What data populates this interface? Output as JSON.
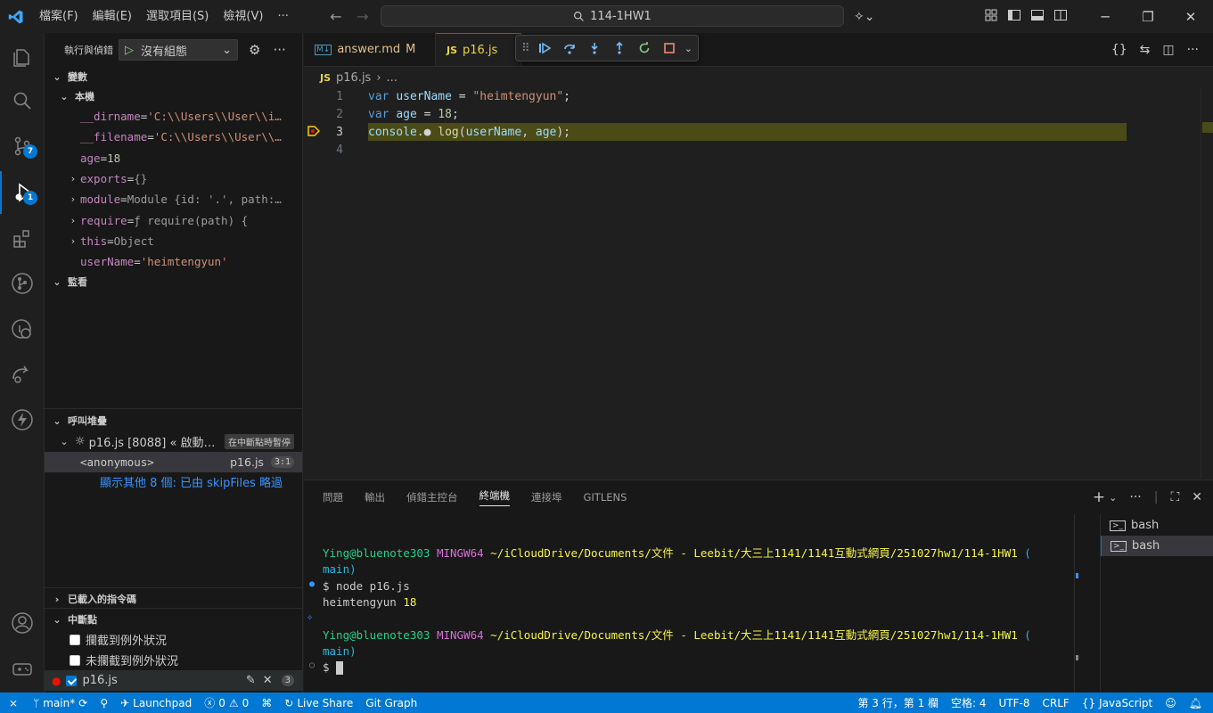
{
  "titlebar": {
    "menus": [
      "檔案(F)",
      "編輯(E)",
      "選取項目(S)",
      "檢視(V)",
      "···"
    ],
    "search": "114-1HW1"
  },
  "activity": {
    "scm_badge": "7",
    "debug_badge": "1"
  },
  "sidebar": {
    "header_title": "執行與偵錯",
    "config_label": "沒有組態",
    "variables_title": "變數",
    "local_title": "本機",
    "variables": [
      {
        "name": "__dirname",
        "sep": " = ",
        "value": "'C:\\\\Users\\\\User\\\\i…",
        "kind": "str",
        "expandable": false
      },
      {
        "name": "__filename",
        "sep": " = ",
        "value": "'C:\\\\Users\\\\User\\\\…",
        "kind": "str",
        "expandable": false
      },
      {
        "name": "age",
        "sep": " = ",
        "value": "18",
        "kind": "num",
        "expandable": false
      },
      {
        "name": "exports",
        "sep": " = ",
        "value": "{}",
        "kind": "obj",
        "expandable": true
      },
      {
        "name": "module",
        "sep": " = ",
        "value": "Module {id: '.', path:…",
        "kind": "obj",
        "expandable": true
      },
      {
        "name": "require",
        "sep": " = ",
        "value": "ƒ require(path) {",
        "kind": "obj",
        "expandable": true
      },
      {
        "name": "this",
        "sep": " = ",
        "value": "Object",
        "kind": "obj",
        "expandable": true
      },
      {
        "name": "userName",
        "sep": " = ",
        "value": "'heimtengyun'",
        "kind": "str",
        "expandable": false
      }
    ],
    "watch_title": "監看",
    "callstack_title": "呼叫堆疊",
    "callstack_thread": "p16.js [8088] « 啟動…",
    "callstack_status": "在中斷點時暫停",
    "frame_name": "<anonymous>",
    "frame_file": "p16.js",
    "frame_pos": "3:1",
    "more_frames": "顯示其他 8 個: 已由 skipFiles 略過",
    "loaded_scripts_title": "已載入的指令碼",
    "breakpoints_title": "中斷點",
    "bp_caught": "攔截到例外狀況",
    "bp_uncaught": "未攔截到例外狀況",
    "bp_file": "p16.js",
    "bp_count": "3"
  },
  "editor": {
    "tabs": [
      {
        "label": "answer.md",
        "status": "M",
        "icon": "M↓"
      },
      {
        "label": "p16.js",
        "icon": "JS"
      }
    ],
    "breadcrumb_file": "p16.js",
    "breadcrumb_more": "...",
    "lines": [
      {
        "n": "1",
        "tokens": [
          [
            "kw",
            "var "
          ],
          [
            "id",
            "userName"
          ],
          [
            "pl",
            " = "
          ],
          [
            "str",
            "\"heimtengyun\""
          ],
          [
            "pl",
            ";"
          ]
        ]
      },
      {
        "n": "2",
        "tokens": [
          [
            "kw",
            "var "
          ],
          [
            "id",
            "age"
          ],
          [
            "pl",
            " = "
          ],
          [
            "num",
            "18"
          ],
          [
            "pl",
            ";"
          ]
        ]
      },
      {
        "n": "3",
        "tokens": [
          [
            "id",
            "console"
          ],
          [
            "pl",
            ".● "
          ],
          [
            "fn",
            "log"
          ],
          [
            "pl",
            "("
          ],
          [
            "id",
            "userName"
          ],
          [
            "pl",
            ", "
          ],
          [
            "id",
            "age"
          ],
          [
            "pl",
            ");"
          ]
        ]
      },
      {
        "n": "4",
        "tokens": []
      }
    ]
  },
  "panel": {
    "tabs": [
      "問題",
      "輸出",
      "偵錯主控台",
      "終端機",
      "連接埠",
      "GITLENS"
    ],
    "active_tab": "終端機",
    "terminals": [
      "bash",
      "bash"
    ],
    "prompt_user": "Ying@bluenote303",
    "prompt_env": "MINGW64",
    "prompt_path": "~/iCloudDrive/Documents/文件 - Leebit/大三上1141/1141互動式網頁/251027hw1/114-1HW1",
    "prompt_branch_open": "(",
    "prompt_branch": "main)",
    "cmd": "$ node p16.js",
    "output": "heimtengyun",
    "output_num": "18",
    "prompt_end": "$"
  },
  "statusbar": {
    "branch": "main*",
    "launchpad": "Launchpad",
    "errors": "0",
    "warnings": "0",
    "liveshare": "Live Share",
    "gitgraph": "Git Graph",
    "position": "第 3 行，第 1 欄",
    "spaces": "空格: 4",
    "encoding": "UTF-8",
    "eol": "CRLF",
    "language": "JavaScript"
  }
}
